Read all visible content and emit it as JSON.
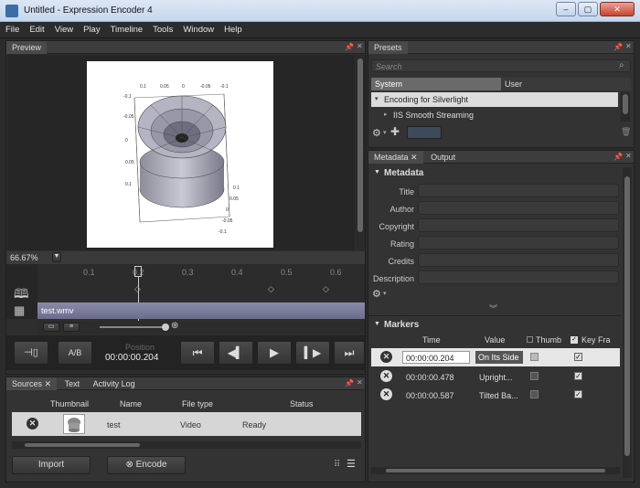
{
  "window": {
    "title": "Untitled - Expression Encoder 4"
  },
  "menu": [
    "File",
    "Edit",
    "View",
    "Play",
    "Timeline",
    "Tools",
    "Window",
    "Help"
  ],
  "preview": {
    "tab": "Preview",
    "zoom": "66.67%",
    "timeline_ticks": [
      "0.1",
      "0.2",
      "0.3",
      "0.4",
      "0.5",
      "0.6"
    ],
    "clip_name": "test.wmv",
    "position_label": "Position",
    "position_value": "00:00:00.204",
    "ab_label": "A/B"
  },
  "presets": {
    "tab": "Presets",
    "search_placeholder": "Search",
    "tabs": [
      "System",
      "User"
    ],
    "items": [
      "Encoding for Silverlight",
      "IIS Smooth Streaming"
    ]
  },
  "metadata": {
    "tabs": [
      "Metadata",
      "Output"
    ],
    "section": "Metadata",
    "fields": [
      "Title",
      "Author",
      "Copyright",
      "Rating",
      "Credits",
      "Description"
    ]
  },
  "markers": {
    "section": "Markers",
    "columns": [
      "Time",
      "Value",
      "Thumb",
      "Key Fra"
    ],
    "rows": [
      {
        "time": "00:00:00.204",
        "value": "On Its Side",
        "thumb": false,
        "key": true
      },
      {
        "time": "00:00:00.478",
        "value": "Upright...",
        "thumb": false,
        "key": true
      },
      {
        "time": "00:00:00.587",
        "value": "Tilted Ba...",
        "thumb": false,
        "key": true
      }
    ]
  },
  "sources": {
    "tabs": [
      "Sources",
      "Text",
      "Activity Log"
    ],
    "columns": [
      "Thumbnail",
      "Name",
      "File type",
      "Status"
    ],
    "rows": [
      {
        "name": "test",
        "type": "Video",
        "status": "Ready"
      }
    ],
    "import_label": "Import",
    "encode_label": "Encode"
  },
  "plot": {
    "top_ticks": [
      "0.1",
      "0.05",
      "0",
      "-0.05",
      "-0.1"
    ],
    "left_ticks": [
      "-0.1",
      "-0.05",
      "0",
      "0.05",
      "0.1"
    ],
    "right_ticks": [
      "0.1",
      "0.05",
      "0",
      "-0.05",
      "-0.1"
    ]
  }
}
